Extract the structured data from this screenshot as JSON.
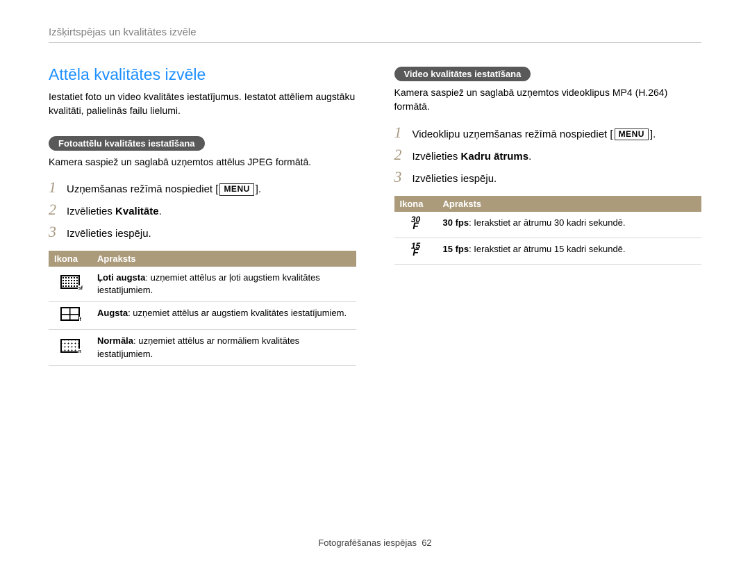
{
  "header": "Izšķirtspējas un kvalitātes izvēle",
  "title": "Attēla kvalitātes izvēle",
  "intro": "Iestatiet foto un video kvalitātes iestatījumus. Iestatot attēliem augstāku kvalitāti, palielinās failu lielumi.",
  "menu_label": "MENU",
  "left": {
    "pill": "Fotoattēlu kvalitātes iestatīšana",
    "sub": "Kamera saspiež un saglabā uzņemtos attēlus JPEG formātā.",
    "step1_a": "Uzņemšanas režīmā nospiediet [",
    "step1_b": "].",
    "step2_a": "Izvēlieties ",
    "step2_bold": "Kvalitāte",
    "step2_b": ".",
    "step3": "Izvēlieties iespēju.",
    "th_icon": "Ikona",
    "th_desc": "Apraksts",
    "rows": [
      {
        "bold": "Ļoti augsta",
        "rest": ": uzņemiet attēlus ar ļoti augstiem kvalitātes iestatījumiem."
      },
      {
        "bold": "Augsta",
        "rest": ": uzņemiet attēlus ar augstiem kvalitātes iestatījumiem."
      },
      {
        "bold": "Normāla",
        "rest": ": uzņemiet attēlus ar normāliem kvalitātes iestatījumiem."
      }
    ]
  },
  "right": {
    "pill": "Video kvalitātes iestatīšana",
    "sub": "Kamera saspiež un saglabā uzņemtos videoklipus MP4 (H.264) formātā.",
    "step1_a": "Videoklipu uzņemšanas režīmā nospiediet [",
    "step1_b": "].",
    "step2_a": "Izvēlieties ",
    "step2_bold": "Kadru ātrums",
    "step2_b": ".",
    "step3": "Izvēlieties iespēju.",
    "th_icon": "Ikona",
    "th_desc": "Apraksts",
    "rows": [
      {
        "num": "30",
        "bold": "30 fps",
        "rest": ": Ierakstiet ar ātrumu 30 kadri sekundē."
      },
      {
        "num": "15",
        "bold": "15 fps",
        "rest": ": Ierakstiet ar ātrumu 15 kadri sekundē."
      }
    ]
  },
  "chart_data": {
    "type": "table",
    "tables": [
      {
        "title": "Fotoattēlu kvalitātes iestatīšana",
        "columns": [
          "Ikona",
          "Apraksts"
        ],
        "rows": [
          [
            "super-fine",
            "Ļoti augsta: uzņemiet attēlus ar ļoti augstiem kvalitātes iestatījumiem."
          ],
          [
            "fine",
            "Augsta: uzņemiet attēlus ar augstiem kvalitātes iestatījumiem."
          ],
          [
            "normal",
            "Normāla: uzņemiet attēlus ar normāliem kvalitātes iestatījumiem."
          ]
        ]
      },
      {
        "title": "Video kvalitātes iestatīšana",
        "columns": [
          "Ikona",
          "Apraksts"
        ],
        "rows": [
          [
            "30F",
            "30 fps: Ierakstiet ar ātrumu 30 kadri sekundē."
          ],
          [
            "15F",
            "15 fps: Ierakstiet ar ātrumu 15 kadri sekundē."
          ]
        ]
      }
    ]
  },
  "footer_label": "Fotografēšanas iespējas",
  "footer_page": "62"
}
